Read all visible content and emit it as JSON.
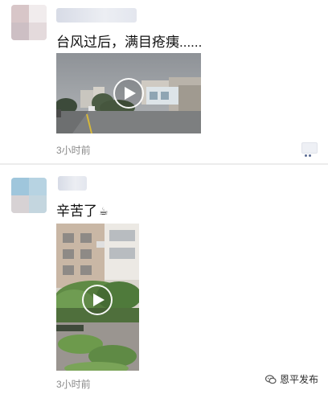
{
  "posts": [
    {
      "text": "台风过后，满目疮痍......",
      "timestamp": "3小时前",
      "media_type": "video",
      "play_icon": "play-icon",
      "comment_icon": "comment-icon"
    },
    {
      "text": "辛苦了",
      "emoji": "☕",
      "timestamp": "3小时前",
      "media_type": "video",
      "play_icon": "play-icon",
      "comment_icon": "comment-icon"
    }
  ],
  "watermark": {
    "text": "恩平发布",
    "icon": "wechat-logo-icon"
  }
}
